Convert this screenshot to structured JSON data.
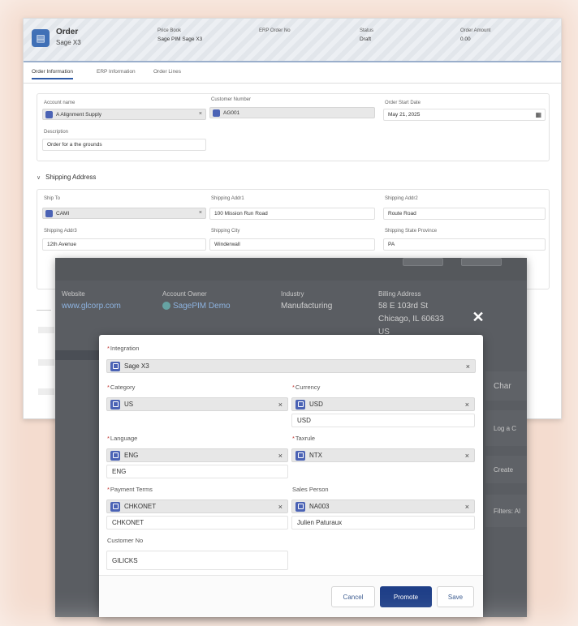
{
  "order": {
    "title": "Order",
    "subtitle": "Sage X3",
    "fields": [
      {
        "label": "Price Book",
        "value": "Sage PIM Sage X3"
      },
      {
        "label": "ERP Order No",
        "value": ""
      },
      {
        "label": "Status",
        "value": "Draft"
      },
      {
        "label": "Order Amount",
        "value": "0.00"
      }
    ],
    "tabs": [
      "Order Information",
      "ERP Information",
      "Order Lines"
    ],
    "info": {
      "account_label": "Account name",
      "account_value": "A Alignment Supply",
      "customer_label": "Customer Number",
      "customer_value": "AG001",
      "start_date_label": "Order Start Date",
      "start_date_value": "May 21, 2025",
      "description_label": "Description",
      "description_value": "Order for a the grounds"
    },
    "shipping": {
      "section_title": "Shipping Address",
      "ship_to_label": "Ship To",
      "ship_to_value": "CAMI",
      "addr1_label": "Shipping Addr1",
      "addr1_value": "100 Mission Run Road",
      "addr2_label": "Shipping Addr2",
      "addr2_value": "Route Road",
      "addr3_label": "Shipping Addr3",
      "addr3_value": "12th Avenue",
      "city_label": "Shipping City",
      "city_value": "Winderwall",
      "state_label": "Shipping State Province",
      "state_value": "PA"
    }
  },
  "account": {
    "website_label": "Website",
    "website_value": "www.glcorp.com",
    "owner_label": "Account Owner",
    "owner_value": "SagePIM Demo",
    "industry_label": "Industry",
    "industry_value": "Manufacturing",
    "billing_label": "Billing Address",
    "billing_line1": "58 E 103rd St",
    "billing_line2": "Chicago, IL 60633",
    "billing_line3": "US",
    "right_items": [
      "Char",
      "Log a C",
      "Create",
      "Filters: Al"
    ],
    "close_symbol": "✕"
  },
  "modal": {
    "integration_label": "Integration",
    "integration_value": "Sage X3",
    "category_label": "Category",
    "category_value": "US",
    "currency_label": "Currency",
    "currency_value": "USD",
    "currency_text": "USD",
    "language_label": "Language",
    "language_value": "ENG",
    "language_text": "ENG",
    "taxrule_label": "Taxrule",
    "taxrule_value": "NTX",
    "payment_label": "Payment Terms",
    "payment_value": "CHKONET",
    "payment_text": "CHKONET",
    "sales_label": "Sales Person",
    "sales_value": "NA003",
    "sales_text": "Julien Paturaux",
    "customer_no_label": "Customer No",
    "customer_no_value": "GILICKS",
    "clear_symbol": "×",
    "cancel_label": "Cancel",
    "promote_label": "Promote",
    "save_label": "Save"
  },
  "colors": {
    "brand": "#1f3f88",
    "lookup_icon": "#4b63b5",
    "overlay": "#5a5d62",
    "background": "#f4dccf"
  }
}
